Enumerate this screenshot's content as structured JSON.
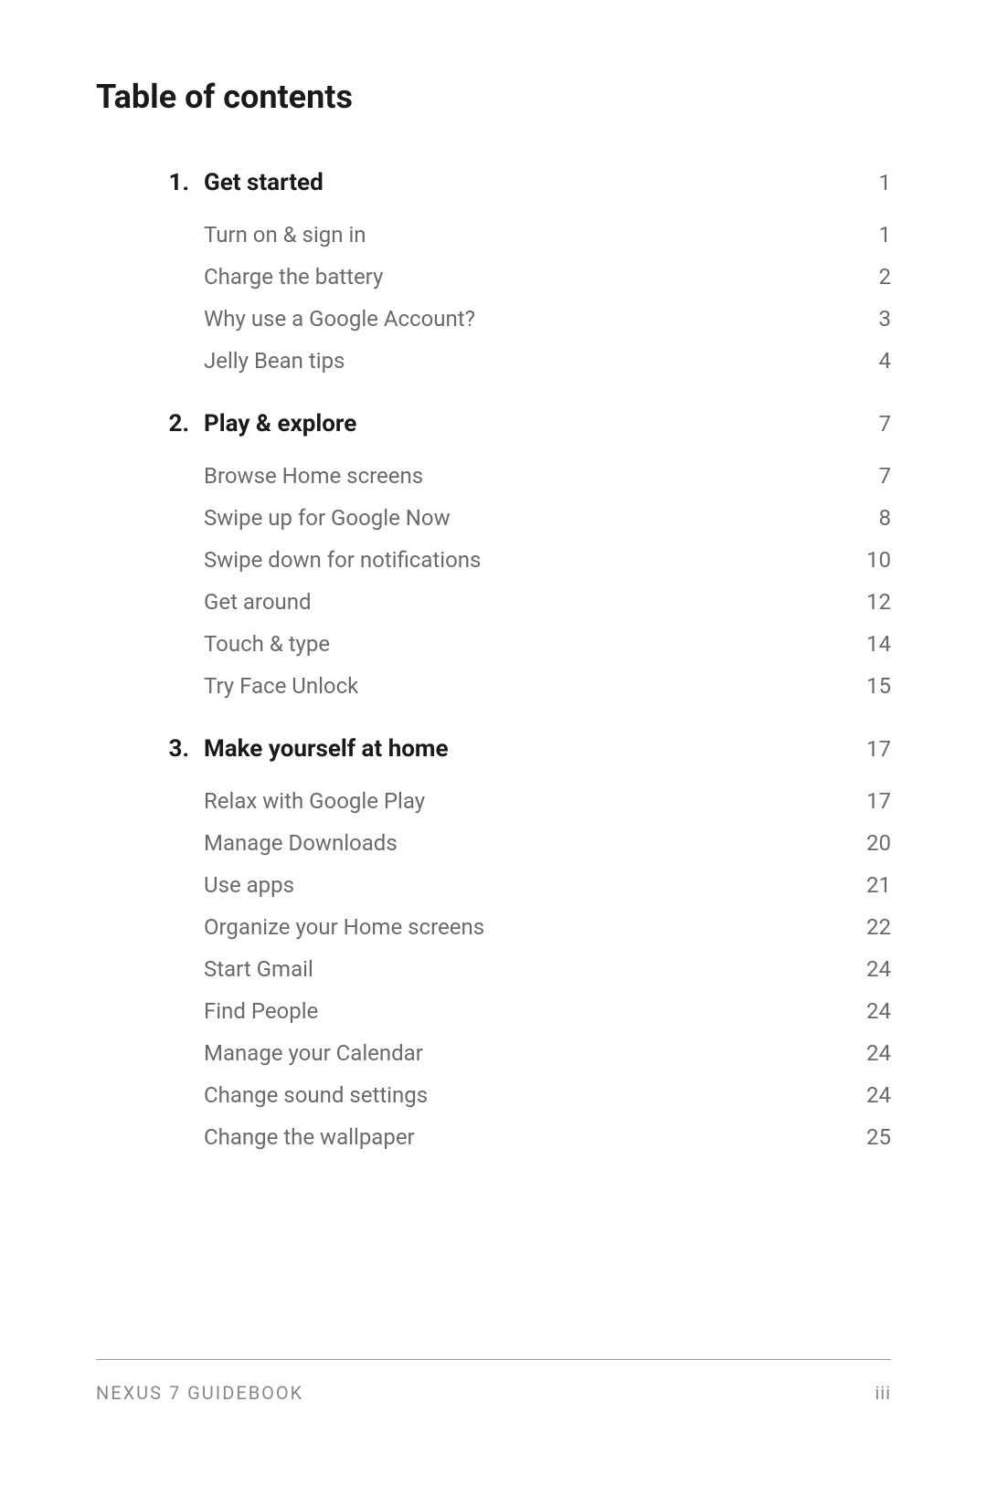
{
  "title": "Table of contents",
  "chapters": [
    {
      "number": "1.",
      "title": "Get started",
      "page": "1",
      "entries": [
        {
          "title": "Turn on & sign in",
          "page": "1"
        },
        {
          "title": "Charge the battery",
          "page": "2"
        },
        {
          "title": "Why use a Google Account?",
          "page": "3"
        },
        {
          "title": "Jelly Bean tips",
          "page": "4"
        }
      ]
    },
    {
      "number": "2.",
      "title": "Play & explore",
      "page": "7",
      "entries": [
        {
          "title": "Browse Home screens",
          "page": "7"
        },
        {
          "title": "Swipe up for Google Now",
          "page": "8"
        },
        {
          "title": "Swipe down for notifications",
          "page": "10"
        },
        {
          "title": "Get around",
          "page": "12"
        },
        {
          "title": "Touch & type",
          "page": "14"
        },
        {
          "title": "Try Face Unlock",
          "page": "15"
        }
      ]
    },
    {
      "number": "3.",
      "title": "Make yourself at home",
      "page": "17",
      "entries": [
        {
          "title": "Relax with Google Play",
          "page": "17"
        },
        {
          "title": "Manage Downloads",
          "page": "20"
        },
        {
          "title": "Use apps",
          "page": "21"
        },
        {
          "title": "Organize your Home screens",
          "page": "22"
        },
        {
          "title": "Start Gmail",
          "page": "24"
        },
        {
          "title": "Find People",
          "page": "24"
        },
        {
          "title": "Manage your Calendar",
          "page": "24"
        },
        {
          "title": "Change sound settings",
          "page": "24"
        },
        {
          "title": "Change the wallpaper",
          "page": "25"
        }
      ]
    }
  ],
  "footer": {
    "left": "NEXUS 7 GUIDEBOOK",
    "right": "iii"
  }
}
